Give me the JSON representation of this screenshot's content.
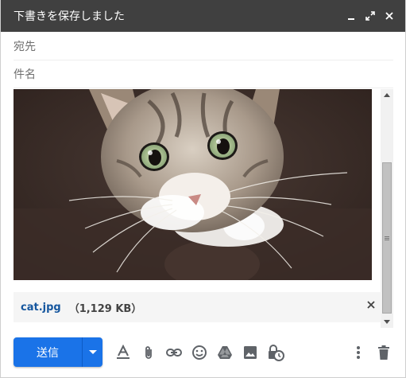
{
  "window": {
    "title": "下書きを保存しました"
  },
  "fields": {
    "to_label": "宛先",
    "subject_label": "件名",
    "to_value": "",
    "subject_value": ""
  },
  "attachment": {
    "filename": "cat.jpg",
    "size": "（1,129 KB）"
  },
  "toolbar": {
    "send_label": "送信"
  },
  "colors": {
    "titlebar": "#404040",
    "send": "#1a73e8",
    "attachment_link": "#15569e",
    "icon": "#5f6368"
  },
  "icons": [
    "minimize-icon",
    "expand-icon",
    "close-icon",
    "format-text-icon",
    "attach-icon",
    "link-icon",
    "emoji-icon",
    "drive-icon",
    "photo-icon",
    "confidential-icon",
    "more-icon",
    "trash-icon"
  ]
}
